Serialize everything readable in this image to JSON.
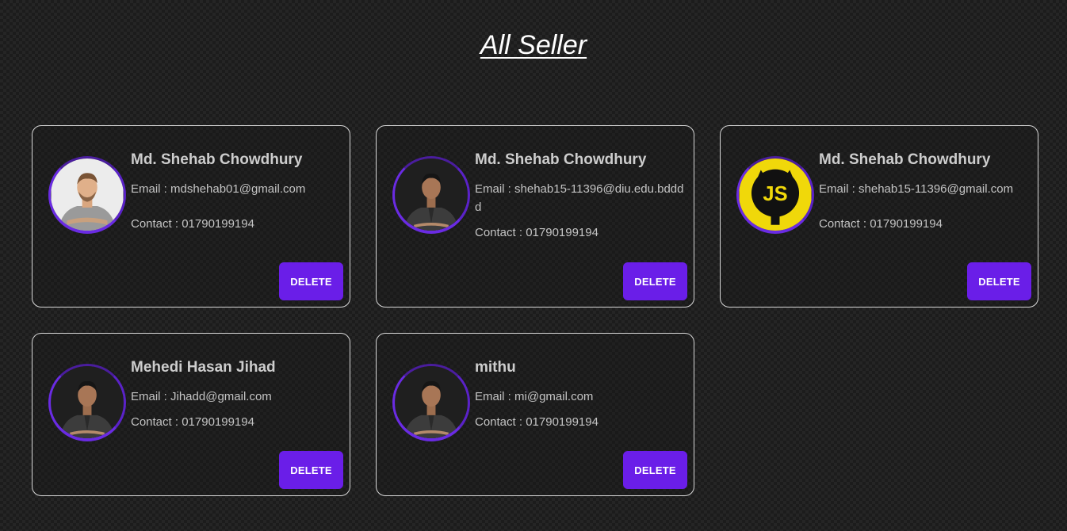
{
  "page": {
    "title": "All Seller"
  },
  "colors": {
    "accent": "#6a1ee8",
    "card_border": "#d8d8d8",
    "background": "#1c1c1c",
    "js_logo_yellow": "#f0d80a"
  },
  "sellers": [
    {
      "name": "Md. Shehab Chowdhury",
      "email": "Email : mdshehab01@gmail.com",
      "contact": "Contact : 01790199194",
      "delete_label": "DELETE",
      "avatar": "man-gray-tshirt-photo"
    },
    {
      "name": "Md. Shehab Chowdhury",
      "email": "Email : shehab15-11396@diu.edu.bdddd",
      "contact": "Contact : 01790199194",
      "delete_label": "DELETE",
      "avatar": "man-dark-shirt-photo"
    },
    {
      "name": "Md. Shehab Chowdhury",
      "email": "Email : shehab15-11396@gmail.com",
      "contact": "Contact : 01790199194",
      "delete_label": "DELETE",
      "avatar": "js-logo",
      "avatar_text": "JS"
    },
    {
      "name": "Mehedi Hasan Jihad",
      "email": "Email : Jihadd@gmail.com",
      "contact": "Contact : 01790199194",
      "delete_label": "DELETE",
      "avatar": "man-dark-shirt-photo"
    },
    {
      "name": "mithu",
      "email": "Email : mi@gmail.com",
      "contact": "Contact : 01790199194",
      "delete_label": "DELETE",
      "avatar": "man-dark-shirt-photo"
    }
  ]
}
